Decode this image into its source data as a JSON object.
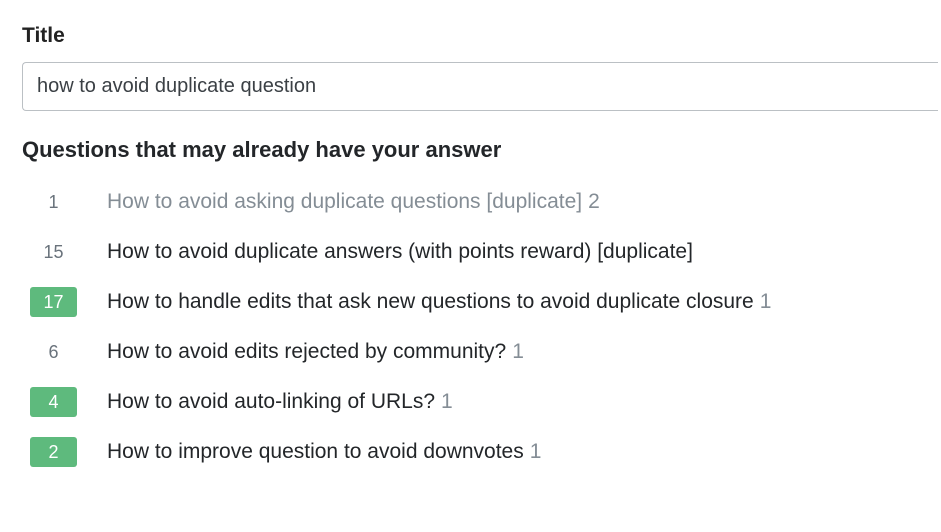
{
  "title": {
    "label": "Title",
    "input_value": "how to avoid duplicate question"
  },
  "suggestions": {
    "header": "Questions that may already have your answer",
    "items": [
      {
        "score": "1",
        "answered": false,
        "title": "How to avoid asking duplicate questions [duplicate]",
        "answer_count": "2",
        "visited": true
      },
      {
        "score": "15",
        "answered": false,
        "title": "How to avoid duplicate answers (with points reward) [duplicate]",
        "answer_count": "",
        "visited": false
      },
      {
        "score": "17",
        "answered": true,
        "title": "How to handle edits that ask new questions to avoid duplicate closure",
        "answer_count": "1",
        "visited": false
      },
      {
        "score": "6",
        "answered": false,
        "title": "How to avoid edits rejected by community?",
        "answer_count": "1",
        "visited": false
      },
      {
        "score": "4",
        "answered": true,
        "title": "How to avoid auto-linking of URLs?",
        "answer_count": "1",
        "visited": false
      },
      {
        "score": "2",
        "answered": true,
        "title": "How to improve question to avoid downvotes",
        "answer_count": "1",
        "visited": false
      }
    ]
  }
}
